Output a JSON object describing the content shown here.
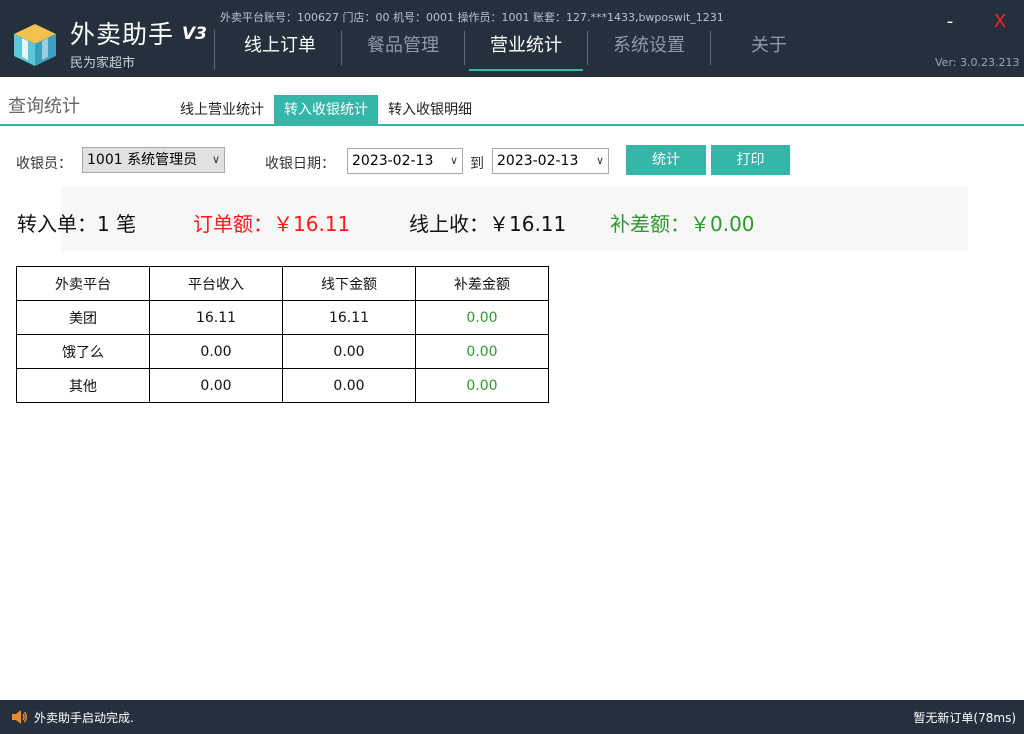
{
  "header": {
    "app_title": "外卖助手",
    "app_version": "V3",
    "store_name": "民为家超市",
    "info_line": "外卖平台账号：100627 门店：00 机号：0001 操作员：1001 账套：127.***1433,bwposwit_1231",
    "version_text": "Ver:  3.0.23.213",
    "minimize_label": "-",
    "close_label": "X",
    "nav": [
      {
        "label": "线上订单"
      },
      {
        "label": "餐品管理"
      },
      {
        "label": "营业统计"
      },
      {
        "label": "系统设置"
      },
      {
        "label": "关于"
      }
    ]
  },
  "page": {
    "section_title": "查询统计",
    "subtabs": [
      {
        "label": "线上营业统计"
      },
      {
        "label": "转入收银统计"
      },
      {
        "label": "转入收银明细"
      }
    ]
  },
  "filters": {
    "cashier_label": "收银员：",
    "cashier_value": "1001 系统管理员",
    "date_label": "收银日期：",
    "date_from": "2023-02-13",
    "to_label": "到",
    "date_to": "2023-02-13",
    "stat_button": "统计",
    "print_button": "打印"
  },
  "summary": {
    "orders_label": "转入单：",
    "orders_value": "1 笔",
    "order_amount_label": "订单额：",
    "order_amount_value": "￥16.11",
    "online_label": "线上收：",
    "online_value": "￥16.11",
    "diff_label": "补差额：",
    "diff_value": "￥0.00",
    "colors": {
      "order_amount": "#ff1a1a",
      "diff": "#2e9a2e",
      "normal": "#111111"
    }
  },
  "table": {
    "headers": [
      "外卖平台",
      "平台收入",
      "线下金额",
      "补差金额"
    ],
    "rows": [
      [
        "美团",
        "16.11",
        "16.11",
        "0.00"
      ],
      [
        "饿了么",
        "0.00",
        "0.00",
        "0.00"
      ],
      [
        "其他",
        "0.00",
        "0.00",
        "0.00"
      ]
    ]
  },
  "status": {
    "icon": "speaker-icon",
    "message": "外卖助手启动完成.",
    "right_text": "暂无新订单(78ms)"
  },
  "theme": {
    "accent": "#35b6a8",
    "header_bg": "#24313d"
  }
}
